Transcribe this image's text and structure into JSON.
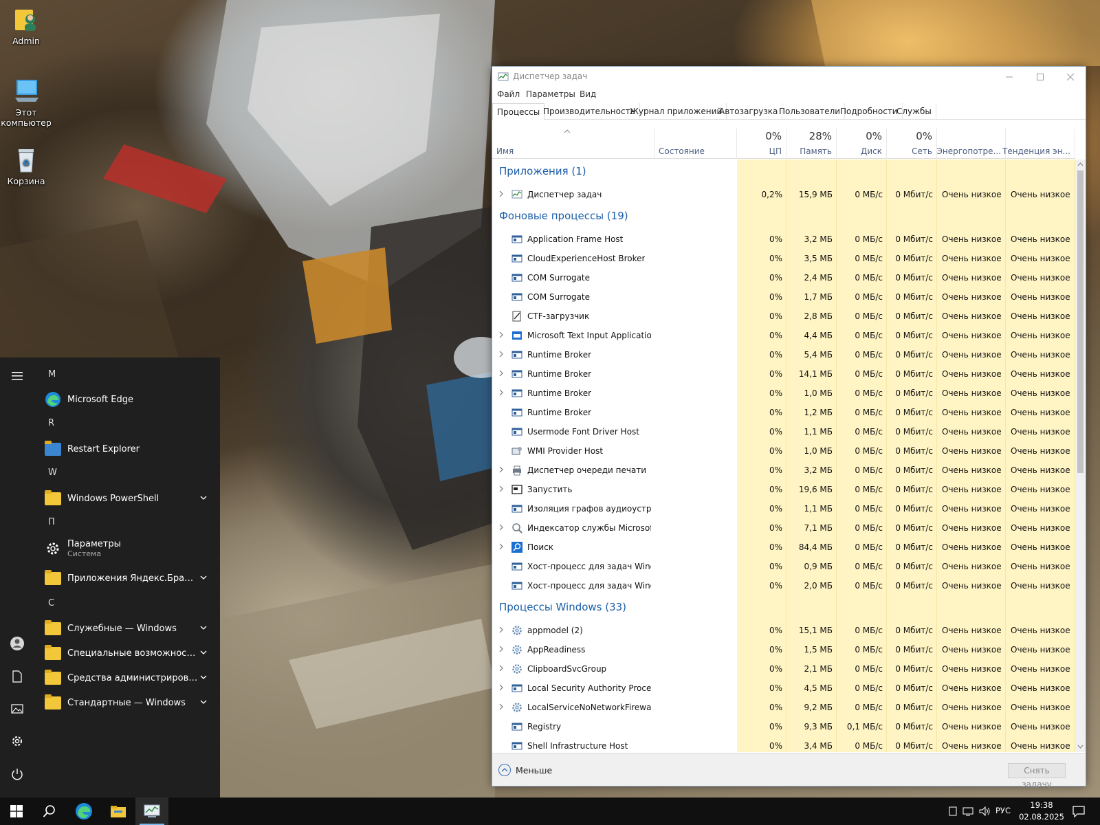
{
  "desktop": {
    "icons": [
      {
        "label": "Admin",
        "icon": "user-folder-icon"
      },
      {
        "label": "Этот компьютер",
        "icon": "computer-icon"
      },
      {
        "label": "Корзина",
        "icon": "recycle-bin-icon"
      }
    ]
  },
  "start_menu": {
    "groups": [
      {
        "letter": "M",
        "items": [
          {
            "label": "Microsoft Edge",
            "icon": "edge-icon"
          }
        ]
      },
      {
        "letter": "R",
        "items": [
          {
            "label": "Restart Explorer",
            "icon": "folder-icon"
          }
        ]
      },
      {
        "letter": "W",
        "items": [
          {
            "label": "Windows PowerShell",
            "icon": "folder-icon",
            "expandable": true
          }
        ]
      },
      {
        "letter": "П",
        "items": [
          {
            "label": "Параметры",
            "sub": "Система",
            "icon": "gear-icon"
          },
          {
            "label": "Приложения Яндекс.Браузер",
            "icon": "folder-icon",
            "expandable": true
          }
        ]
      },
      {
        "letter": "С",
        "items": [
          {
            "label": "Служебные — Windows",
            "icon": "folder-icon",
            "expandable": true
          },
          {
            "label": "Специальные возможности Win...",
            "icon": "folder-icon",
            "expandable": true
          },
          {
            "label": "Средства администрирования W...",
            "icon": "folder-icon",
            "expandable": true
          },
          {
            "label": "Стандартные — Windows",
            "icon": "folder-icon",
            "expandable": true
          }
        ]
      }
    ]
  },
  "taskbar": {
    "lang": "РУС",
    "time": "19:38",
    "date": "02.08.2025"
  },
  "task_manager": {
    "title": "Диспетчер задач",
    "menu": [
      "Файл",
      "Параметры",
      "Вид"
    ],
    "tabs": [
      "Процессы",
      "Производительность",
      "Журнал приложений",
      "Автозагрузка",
      "Пользователи",
      "Подробности",
      "Службы"
    ],
    "active_tab": "Процессы",
    "columns": {
      "name": "Имя",
      "status": "Состояние",
      "cpu": {
        "pct": "0%",
        "label": "ЦП"
      },
      "memory": {
        "pct": "28%",
        "label": "Память"
      },
      "disk": {
        "pct": "0%",
        "label": "Диск"
      },
      "network": {
        "pct": "0%",
        "label": "Сеть"
      },
      "power": "Энергопотре...",
      "power_trend": "Тенденция эн..."
    },
    "sections": [
      {
        "title": "Приложения (1)",
        "rows": [
          {
            "name": "Диспетчер задач",
            "cpu": "0,2%",
            "mem": "15,9 МБ",
            "disk": "0 МБ/с",
            "net": "0 Мбит/с",
            "power": "Очень низкое",
            "trend": "Очень низкое",
            "expand": true,
            "icon": "taskmgr"
          }
        ]
      },
      {
        "title": "Фоновые процессы (19)",
        "rows": [
          {
            "name": "Application Frame Host",
            "cpu": "0%",
            "mem": "3,2 МБ",
            "disk": "0 МБ/с",
            "net": "0 Мбит/с",
            "power": "Очень низкое",
            "trend": "Очень низкое",
            "expand": false,
            "icon": "app"
          },
          {
            "name": "CloudExperienceHost Broker",
            "cpu": "0%",
            "mem": "3,5 МБ",
            "disk": "0 МБ/с",
            "net": "0 Мбит/с",
            "power": "Очень низкое",
            "trend": "Очень низкое",
            "expand": false,
            "icon": "app"
          },
          {
            "name": "COM Surrogate",
            "cpu": "0%",
            "mem": "2,4 МБ",
            "disk": "0 МБ/с",
            "net": "0 Мбит/с",
            "power": "Очень низкое",
            "trend": "Очень низкое",
            "expand": false,
            "icon": "app"
          },
          {
            "name": "COM Surrogate",
            "cpu": "0%",
            "mem": "1,7 МБ",
            "disk": "0 МБ/с",
            "net": "0 Мбит/с",
            "power": "Очень низкое",
            "trend": "Очень низкое",
            "expand": false,
            "icon": "app"
          },
          {
            "name": "CTF-загрузчик",
            "cpu": "0%",
            "mem": "2,8 МБ",
            "disk": "0 МБ/с",
            "net": "0 Мбит/с",
            "power": "Очень низкое",
            "trend": "Очень низкое",
            "expand": false,
            "icon": "ctf"
          },
          {
            "name": "Microsoft Text Input Application",
            "cpu": "0%",
            "mem": "4,4 МБ",
            "disk": "0 МБ/с",
            "net": "0 Мбит/с",
            "power": "Очень низкое",
            "trend": "Очень низкое",
            "expand": true,
            "icon": "blue"
          },
          {
            "name": "Runtime Broker",
            "cpu": "0%",
            "mem": "5,4 МБ",
            "disk": "0 МБ/с",
            "net": "0 Мбит/с",
            "power": "Очень низкое",
            "trend": "Очень низкое",
            "expand": true,
            "icon": "app"
          },
          {
            "name": "Runtime Broker",
            "cpu": "0%",
            "mem": "14,1 МБ",
            "disk": "0 МБ/с",
            "net": "0 Мбит/с",
            "power": "Очень низкое",
            "trend": "Очень низкое",
            "expand": true,
            "icon": "app"
          },
          {
            "name": "Runtime Broker",
            "cpu": "0%",
            "mem": "1,0 МБ",
            "disk": "0 МБ/с",
            "net": "0 Мбит/с",
            "power": "Очень низкое",
            "trend": "Очень низкое",
            "expand": true,
            "icon": "app"
          },
          {
            "name": "Runtime Broker",
            "cpu": "0%",
            "mem": "1,2 МБ",
            "disk": "0 МБ/с",
            "net": "0 Мбит/с",
            "power": "Очень низкое",
            "trend": "Очень низкое",
            "expand": false,
            "icon": "app"
          },
          {
            "name": "Usermode Font Driver Host",
            "cpu": "0%",
            "mem": "1,1 МБ",
            "disk": "0 МБ/с",
            "net": "0 Мбит/с",
            "power": "Очень низкое",
            "trend": "Очень низкое",
            "expand": false,
            "icon": "app"
          },
          {
            "name": "WMI Provider Host",
            "cpu": "0%",
            "mem": "1,0 МБ",
            "disk": "0 МБ/с",
            "net": "0 Мбит/с",
            "power": "Очень низкое",
            "trend": "Очень низкое",
            "expand": false,
            "icon": "wmi"
          },
          {
            "name": "Диспетчер очереди печати",
            "cpu": "0%",
            "mem": "3,2 МБ",
            "disk": "0 МБ/с",
            "net": "0 Мбит/с",
            "power": "Очень низкое",
            "trend": "Очень низкое",
            "expand": true,
            "icon": "printer"
          },
          {
            "name": "Запустить",
            "cpu": "0%",
            "mem": "19,6 МБ",
            "disk": "0 МБ/с",
            "net": "0 Мбит/с",
            "power": "Очень низкое",
            "trend": "Очень низкое",
            "expand": true,
            "icon": "run"
          },
          {
            "name": "Изоляция графов аудиоустро...",
            "cpu": "0%",
            "mem": "1,1 МБ",
            "disk": "0 МБ/с",
            "net": "0 Мбит/с",
            "power": "Очень низкое",
            "trend": "Очень низкое",
            "expand": false,
            "icon": "app"
          },
          {
            "name": "Индексатор службы Microsoft ...",
            "cpu": "0%",
            "mem": "7,1 МБ",
            "disk": "0 МБ/с",
            "net": "0 Мбит/с",
            "power": "Очень низкое",
            "trend": "Очень низкое",
            "expand": true,
            "icon": "indexer"
          },
          {
            "name": "Поиск",
            "cpu": "0%",
            "mem": "84,4 МБ",
            "disk": "0 МБ/с",
            "net": "0 Мбит/с",
            "power": "Очень низкое",
            "trend": "Очень низкое",
            "expand": true,
            "icon": "search"
          },
          {
            "name": "Хост-процесс для задач Windo...",
            "cpu": "0%",
            "mem": "0,9 МБ",
            "disk": "0 МБ/с",
            "net": "0 Мбит/с",
            "power": "Очень низкое",
            "trend": "Очень низкое",
            "expand": false,
            "icon": "app"
          },
          {
            "name": "Хост-процесс для задач Windo...",
            "cpu": "0%",
            "mem": "2,0 МБ",
            "disk": "0 МБ/с",
            "net": "0 Мбит/с",
            "power": "Очень низкое",
            "trend": "Очень низкое",
            "expand": false,
            "icon": "app"
          }
        ]
      },
      {
        "title": "Процессы Windows (33)",
        "rows": [
          {
            "name": "appmodel (2)",
            "cpu": "0%",
            "mem": "15,1 МБ",
            "disk": "0 МБ/с",
            "net": "0 Мбит/с",
            "power": "Очень низкое",
            "trend": "Очень низкое",
            "expand": true,
            "icon": "gear"
          },
          {
            "name": "AppReadiness",
            "cpu": "0%",
            "mem": "1,5 МБ",
            "disk": "0 МБ/с",
            "net": "0 Мбит/с",
            "power": "Очень низкое",
            "trend": "Очень низкое",
            "expand": true,
            "icon": "gear"
          },
          {
            "name": "ClipboardSvcGroup",
            "cpu": "0%",
            "mem": "2,1 МБ",
            "disk": "0 МБ/с",
            "net": "0 Мбит/с",
            "power": "Очень низкое",
            "trend": "Очень низкое",
            "expand": true,
            "icon": "gear"
          },
          {
            "name": "Local Security Authority Process...",
            "cpu": "0%",
            "mem": "4,5 МБ",
            "disk": "0 МБ/с",
            "net": "0 Мбит/с",
            "power": "Очень низкое",
            "trend": "Очень низкое",
            "expand": true,
            "icon": "app"
          },
          {
            "name": "LocalServiceNoNetworkFirewall ...",
            "cpu": "0%",
            "mem": "9,2 МБ",
            "disk": "0 МБ/с",
            "net": "0 Мбит/с",
            "power": "Очень низкое",
            "trend": "Очень низкое",
            "expand": true,
            "icon": "gear"
          },
          {
            "name": "Registry",
            "cpu": "0%",
            "mem": "9,3 МБ",
            "disk": "0,1 МБ/с",
            "net": "0 Мбит/с",
            "power": "Очень низкое",
            "trend": "Очень низкое",
            "expand": false,
            "icon": "app"
          },
          {
            "name": "Shell Infrastructure Host",
            "cpu": "0%",
            "mem": "3,4 МБ",
            "disk": "0 МБ/с",
            "net": "0 Мбит/с",
            "power": "Очень низкое",
            "trend": "Очень низкое",
            "expand": false,
            "icon": "app"
          }
        ]
      }
    ],
    "footer": {
      "fewer": "Меньше",
      "end_task": "Снять задачу"
    }
  }
}
